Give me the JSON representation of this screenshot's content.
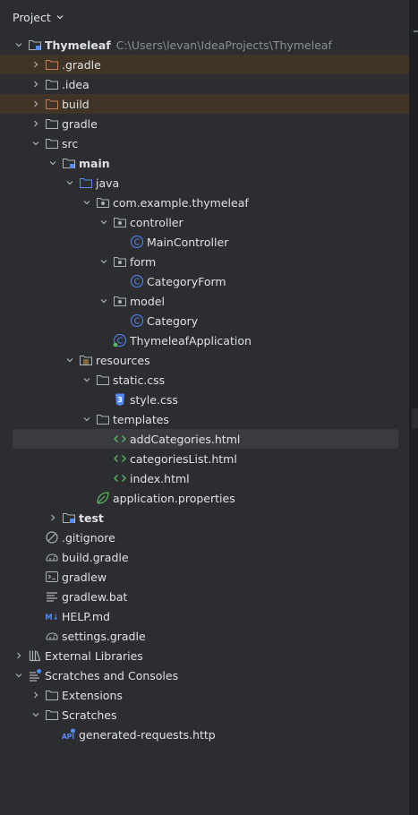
{
  "header": {
    "title": "Project"
  },
  "root": {
    "name": "Thymeleaf",
    "path": "C:\\Users\\levan\\IdeaProjects\\Thymeleaf"
  },
  "tree": {
    "gradle_hidden": ".gradle",
    "idea": ".idea",
    "build": "build",
    "gradle": "gradle",
    "src": "src",
    "main": "main",
    "java": "java",
    "package": "com.example.thymeleaf",
    "controller": "controller",
    "main_controller": "MainController",
    "form": "form",
    "category_form": "CategoryForm",
    "model": "model",
    "category": "Category",
    "application_class": "ThymeleafApplication",
    "resources": "resources",
    "static_css": "static.css",
    "style_css": "style.css",
    "templates": "templates",
    "add_categories": "addCategories.html",
    "categories_list": "categoriesList.html",
    "index_html": "index.html",
    "application_properties": "application.properties",
    "test": "test",
    "gitignore": ".gitignore",
    "build_gradle": "build.gradle",
    "gradlew": "gradlew",
    "gradlew_bat": "gradlew.bat",
    "help_md": "HELP.md",
    "settings_gradle": "settings.gradle",
    "external_libraries": "External Libraries",
    "scratches_consoles": "Scratches and Consoles",
    "extensions": "Extensions",
    "scratches": "Scratches",
    "generated_requests": "generated-requests.http"
  },
  "icons": {
    "help_md": "M↓",
    "class_letter": "C"
  },
  "colors": {
    "background": "#2b2d30",
    "excluded_row": "#3f3426",
    "selected_row": "#393b40",
    "folder_source": "#548af7",
    "folder_excluded": "#c77d55",
    "java_class": "#548af7"
  }
}
